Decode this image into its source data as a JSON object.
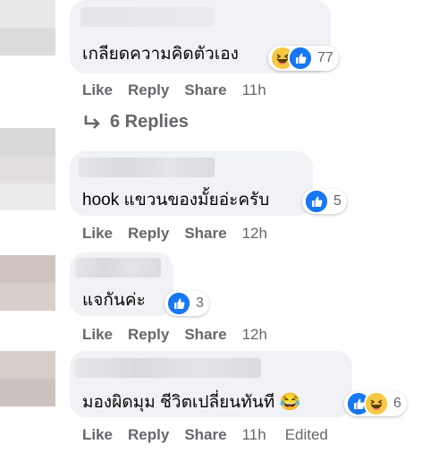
{
  "comments": [
    {
      "text": "เกลียดความคิดตัวเอง",
      "reaction_count": "77",
      "actions": {
        "like": "Like",
        "reply": "Reply",
        "share": "Share",
        "time": "11h"
      }
    },
    {
      "text": "hook แขวนของมั้ยอ่ะครับ",
      "reaction_count": "5",
      "actions": {
        "like": "Like",
        "reply": "Reply",
        "share": "Share",
        "time": "12h"
      }
    },
    {
      "text": "แจกันค่ะ",
      "reaction_count": "3",
      "actions": {
        "like": "Like",
        "reply": "Reply",
        "share": "Share",
        "time": "12h"
      }
    },
    {
      "text": "มองผิดมุม ชีวิตเปลี่ยนทันที 😂",
      "reaction_count": "6",
      "actions": {
        "like": "Like",
        "reply": "Reply",
        "share": "Share",
        "time": "11h",
        "edited": "Edited"
      }
    }
  ],
  "replies_label": "6 Replies",
  "colors": {
    "bubble": "#f0f2f5",
    "meta": "#65676b",
    "like": "#1877f2",
    "haha": "#f7c842"
  }
}
